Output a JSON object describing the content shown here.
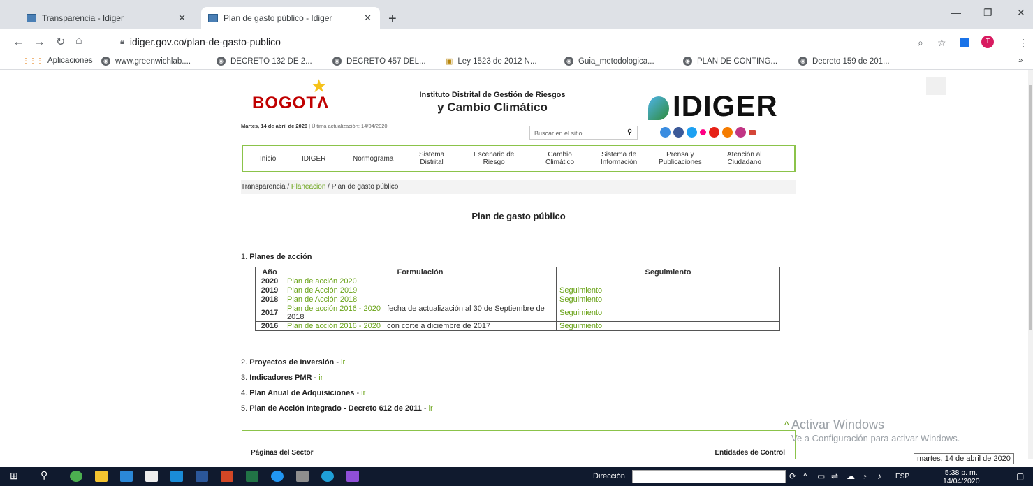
{
  "browser": {
    "tabs": [
      {
        "title": "Transparencia - Idiger"
      },
      {
        "title": "Plan de gasto público - Idiger"
      }
    ],
    "url": "idiger.gov.co/plan-de-gasto-publico",
    "bookmarks": [
      "Aplicaciones",
      "www.greenwichlab....",
      "DECRETO 132 DE 2...",
      "DECRETO 457 DEL...",
      "Ley 1523 de 2012 N...",
      "Guia_metodologica...",
      "PLAN DE CONTING...",
      "Decreto 159 de 201..."
    ],
    "profile_initial": "T"
  },
  "site": {
    "logo_bogota": "BOGOT",
    "logo_bogota_a": "Λ",
    "inst_line1": "Instituto Distrital de Gestión de Riesgos",
    "inst_line2": "y Cambio Climático",
    "logo_idiger": "IDIGER",
    "date_bold": "Martes, 14 de abril de 2020",
    "date_rest": " | Última actualización: 14/04/2020",
    "search_placeholder": "Buscar en el sitio...",
    "menu": [
      "Inicio",
      "IDIGER",
      "Normograma",
      "Sistema\nDistrital",
      "Escenario de\nRiesgo",
      "Cambio\nClimático",
      "Sistema de\nInformación",
      "Prensa y\nPublicaciones",
      "Atención al\nCiudadano"
    ],
    "breadcrumb": {
      "a": "Transparencia",
      "sep1": " / ",
      "b": "Planeacion",
      "sep2": " / Plan de gasto público"
    },
    "page_title": "Plan de gasto público",
    "section1": {
      "num": "1. ",
      "label": "Planes de acción"
    },
    "table": {
      "headers": [
        "Año",
        "Formulación",
        "Seguimiento"
      ],
      "rows": [
        {
          "year": "2020",
          "link": "Plan de acción 2020",
          "note": "",
          "seg": ""
        },
        {
          "year": "2019",
          "link": "Plan de Acción 2019",
          "note": "",
          "seg": "Seguimiento"
        },
        {
          "year": "2018",
          "link": "Plan de Acción 2018",
          "note": "",
          "seg": "Seguimiento"
        },
        {
          "year": "2017",
          "link": "Plan de acción 2016 - 2020",
          "note": "   fecha de actualización al 30 de Septiembre de 2018",
          "seg": "Seguimiento"
        },
        {
          "year": "2016",
          "link": "Plan de acción 2016 - 2020",
          "note": "   con corte a diciembre de 2017",
          "seg": "Seguimiento"
        }
      ]
    },
    "sections": [
      {
        "num": "2. ",
        "label": "Proyectos de Inversión",
        "link": "ir"
      },
      {
        "num": "3. ",
        "label": "Indicadores PMR",
        "link": "ir"
      },
      {
        "num": "4. ",
        "label": "Plan Anual de Adquisiciones",
        "link": "ir"
      },
      {
        "num": "5. ",
        "label": "Plan de Acción Integrado - Decreto 612 de 2011",
        "link": "ir"
      }
    ],
    "footer_left": "Páginas del Sector",
    "footer_right": "Entidades de Control"
  },
  "os": {
    "watermark1": "Activar Windows",
    "watermark2": "Ve a Configuración para activar Windows.",
    "tooltip": "martes, 14 de abril de 2020",
    "address_label": "Dirección",
    "lang": "ESP",
    "time": "5:38 p. m.",
    "date": "14/04/2020"
  }
}
